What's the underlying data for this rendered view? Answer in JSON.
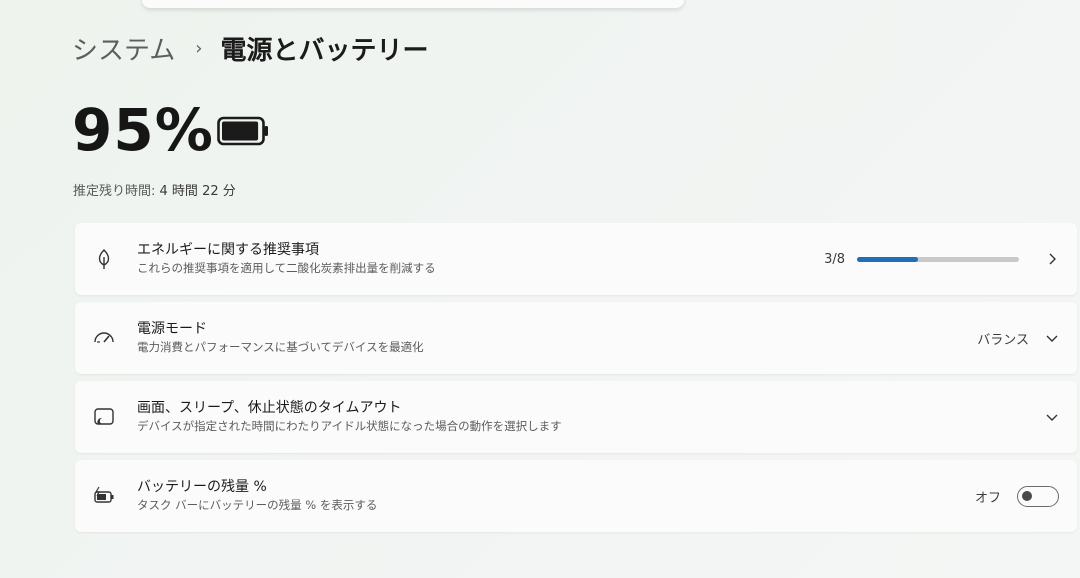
{
  "breadcrumb": {
    "parent": "システム",
    "separator": "›",
    "current": "電源とバッテリー"
  },
  "battery": {
    "percent_text": "95%",
    "level": 0.95,
    "icon": "battery-icon",
    "remaining_label": "推定残り時間:",
    "remaining_value": "4 時間 22 分"
  },
  "cards": {
    "energy": {
      "icon": "leaf-icon",
      "title": "エネルギーに関する推奨事項",
      "description": "これらの推奨事項を適用して二酸化炭素排出量を削減する",
      "progress_text": "3/8",
      "progress_fraction": 0.375
    },
    "power_mode": {
      "icon": "gauge-icon",
      "title": "電源モード",
      "description": "電力消費とパフォーマンスに基づいてデバイスを最適化",
      "value": "バランス"
    },
    "screen_sleep": {
      "icon": "screen-moon-icon",
      "title": "画面、スリープ、休止状態のタイムアウト",
      "description": "デバイスが指定された時間にわたりアイドル状態になった場合の動作を選択します"
    },
    "battery_percent": {
      "icon": "battery-charging-icon",
      "title": "バッテリーの残量 %",
      "description": "タスク バーにバッテリーの残量 % を表示する",
      "toggle_label": "オフ",
      "toggle_on": false
    }
  },
  "colors": {
    "accent": "#1c6fb8",
    "track": "#c9c9c9",
    "card": "#fbfbfb"
  }
}
